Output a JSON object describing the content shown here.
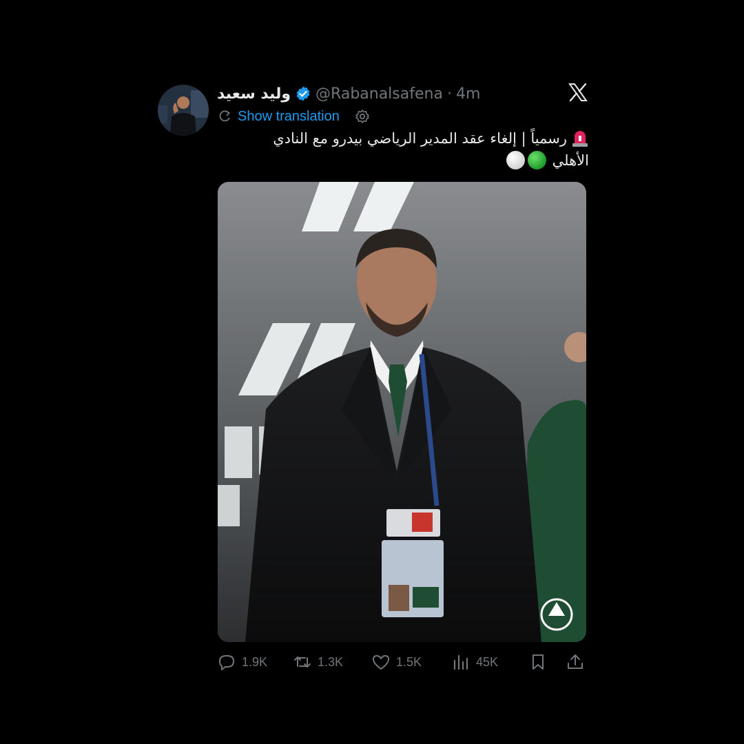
{
  "user": {
    "display_name": "وليد سعيد",
    "handle": "@Rabanalsafena",
    "separator": "·",
    "time": "4m",
    "verified_color": "#1d9bf0"
  },
  "translate": {
    "label": "Show translation"
  },
  "tweet": {
    "line1": "رسمياً | إلغاء عقد المدير الرياضي بيدرو مع النادي",
    "line2": "الأهلي"
  },
  "stats": {
    "replies": "1.9K",
    "retweets": "1.3K",
    "likes": "1.5K",
    "views": "45K"
  },
  "colors": {
    "background": "#000000",
    "text": "#e7e9ea",
    "muted": "#71767b",
    "accent": "#1d9bf0"
  },
  "icons": {
    "platform": "x-logo-icon",
    "reply": "reply-icon",
    "retweet": "retweet-icon",
    "like": "heart-icon",
    "views": "views-icon",
    "bookmark": "bookmark-icon",
    "share": "share-icon"
  }
}
